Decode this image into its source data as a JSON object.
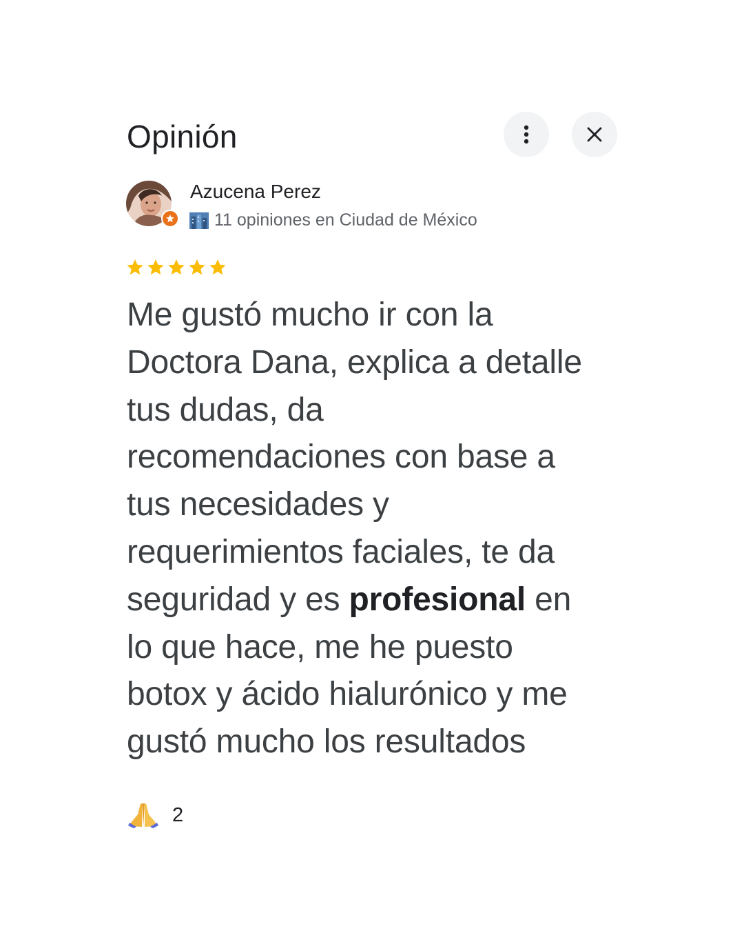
{
  "header": {
    "title": "Opinión",
    "more_icon": "more-vert-icon",
    "close_icon": "close-icon"
  },
  "author": {
    "name": "Azucena Perez",
    "meta": "11 opiniones en Ciudad de México",
    "avatar_icon": "user-avatar",
    "badge_icon": "local-guide-star-icon",
    "meta_icon": "city-icon"
  },
  "rating": {
    "stars": 5,
    "max": 5,
    "color": "#fbbc04"
  },
  "review": {
    "lines": [
      "Me gustó mucho ir con la",
      "Doctora Dana, explica a detalle",
      "tus dudas, da",
      "recomendaciones con base a",
      "tus necesidades y",
      "requerimientos faciales, te da",
      "seguridad y es ",
      "profesional",
      " en",
      "lo que hace, me he puesto",
      "botox y ácido hialurónico y me",
      "gustó mucho los resultados"
    ]
  },
  "reaction": {
    "icon": "folded-hands-icon",
    "count": "2"
  },
  "colors": {
    "accent_star": "#fbbc04",
    "badge": "#e8711a",
    "button_bg": "#f1f3f4"
  }
}
